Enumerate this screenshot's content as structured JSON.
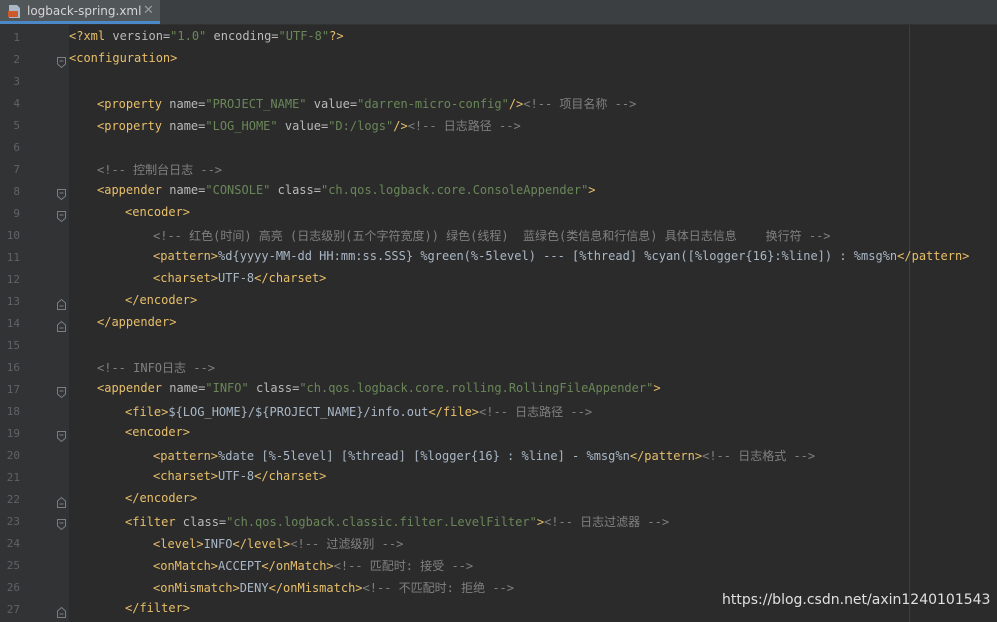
{
  "tab": {
    "label": "logback-spring.xml",
    "close": "✕",
    "icon": "xml-file-icon"
  },
  "lines": [
    {
      "n": "1",
      "fold": "",
      "indent": 0,
      "seg": [
        [
          "t",
          "<?xml "
        ],
        [
          "a",
          "version="
        ],
        [
          "v",
          "\"1.0\""
        ],
        [
          "a",
          " encoding="
        ],
        [
          "v",
          "\"UTF-8\""
        ],
        [
          "t",
          "?>"
        ]
      ]
    },
    {
      "n": "2",
      "fold": "open",
      "indent": 0,
      "seg": [
        [
          "t",
          "<configuration>"
        ]
      ]
    },
    {
      "n": "3",
      "fold": "",
      "indent": 0,
      "seg": []
    },
    {
      "n": "4",
      "fold": "",
      "indent": 1,
      "seg": [
        [
          "t",
          "<property "
        ],
        [
          "a",
          "name="
        ],
        [
          "v",
          "\"PROJECT_NAME\""
        ],
        [
          "a",
          " value="
        ],
        [
          "v",
          "\"darren-micro-config\""
        ],
        [
          "t",
          "/>"
        ],
        [
          "c",
          "<!-- 项目名称 -->"
        ]
      ]
    },
    {
      "n": "5",
      "fold": "",
      "indent": 1,
      "seg": [
        [
          "t",
          "<property "
        ],
        [
          "a",
          "name="
        ],
        [
          "v",
          "\"LOG_HOME\""
        ],
        [
          "a",
          " value="
        ],
        [
          "v",
          "\"D:/logs\""
        ],
        [
          "t",
          "/>"
        ],
        [
          "c",
          "<!-- 日志路径 -->"
        ]
      ]
    },
    {
      "n": "6",
      "fold": "",
      "indent": 0,
      "seg": []
    },
    {
      "n": "7",
      "fold": "",
      "indent": 1,
      "seg": [
        [
          "c",
          "<!-- 控制台日志 -->"
        ]
      ]
    },
    {
      "n": "8",
      "fold": "open",
      "indent": 1,
      "seg": [
        [
          "t",
          "<appender "
        ],
        [
          "a",
          "name="
        ],
        [
          "v",
          "\"CONSOLE\""
        ],
        [
          "a",
          " class="
        ],
        [
          "v",
          "\"ch.qos.logback.core.ConsoleAppender\""
        ],
        [
          "t",
          ">"
        ]
      ]
    },
    {
      "n": "9",
      "fold": "open",
      "indent": 2,
      "seg": [
        [
          "t",
          "<encoder>"
        ]
      ]
    },
    {
      "n": "10",
      "fold": "",
      "indent": 3,
      "seg": [
        [
          "c",
          "<!-- 红色(时间) 高亮 (日志级别(五个字符宽度)) 绿色(线程)  蓝绿色(类信息和行信息) 具体日志信息    换行符 -->"
        ]
      ]
    },
    {
      "n": "11",
      "fold": "",
      "indent": 3,
      "seg": [
        [
          "t",
          "<pattern>"
        ],
        [
          "x",
          "%d{yyyy-MM-dd HH:mm:ss.SSS} %green(%-5level) --- [%thread] %cyan([%logger{16}:%line]) : %msg%n"
        ],
        [
          "t",
          "</pattern>"
        ]
      ]
    },
    {
      "n": "12",
      "fold": "",
      "indent": 3,
      "seg": [
        [
          "t",
          "<charset>"
        ],
        [
          "x",
          "UTF-8"
        ],
        [
          "t",
          "</charset>"
        ]
      ]
    },
    {
      "n": "13",
      "fold": "close",
      "indent": 2,
      "seg": [
        [
          "t",
          "</encoder>"
        ]
      ]
    },
    {
      "n": "14",
      "fold": "close",
      "indent": 1,
      "seg": [
        [
          "t",
          "</appender>"
        ]
      ]
    },
    {
      "n": "15",
      "fold": "",
      "indent": 0,
      "seg": []
    },
    {
      "n": "16",
      "fold": "",
      "indent": 1,
      "seg": [
        [
          "c",
          "<!-- INFO日志 -->"
        ]
      ]
    },
    {
      "n": "17",
      "fold": "open",
      "indent": 1,
      "seg": [
        [
          "t",
          "<appender "
        ],
        [
          "a",
          "name="
        ],
        [
          "v",
          "\"INFO\""
        ],
        [
          "a",
          " class="
        ],
        [
          "v",
          "\"ch.qos.logback.core.rolling.RollingFileAppender\""
        ],
        [
          "t",
          ">"
        ]
      ]
    },
    {
      "n": "18",
      "fold": "",
      "indent": 2,
      "seg": [
        [
          "t",
          "<file>"
        ],
        [
          "x",
          "${LOG_HOME}/${PROJECT_NAME}/info.out"
        ],
        [
          "t",
          "</file>"
        ],
        [
          "c",
          "<!-- 日志路径 -->"
        ]
      ]
    },
    {
      "n": "19",
      "fold": "open",
      "indent": 2,
      "seg": [
        [
          "t",
          "<encoder>"
        ]
      ]
    },
    {
      "n": "20",
      "fold": "",
      "indent": 3,
      "seg": [
        [
          "t",
          "<pattern>"
        ],
        [
          "x",
          "%date [%-5level] [%thread] [%logger{16} : %line] - %msg%n"
        ],
        [
          "t",
          "</pattern>"
        ],
        [
          "c",
          "<!-- 日志格式 -->"
        ]
      ]
    },
    {
      "n": "21",
      "fold": "",
      "indent": 3,
      "seg": [
        [
          "t",
          "<charset>"
        ],
        [
          "x",
          "UTF-8"
        ],
        [
          "t",
          "</charset>"
        ]
      ]
    },
    {
      "n": "22",
      "fold": "close",
      "indent": 2,
      "seg": [
        [
          "t",
          "</encoder>"
        ]
      ]
    },
    {
      "n": "23",
      "fold": "open",
      "indent": 2,
      "seg": [
        [
          "t",
          "<filter "
        ],
        [
          "a",
          "class="
        ],
        [
          "v",
          "\"ch.qos.logback.classic.filter.LevelFilter\""
        ],
        [
          "t",
          ">"
        ],
        [
          "c",
          "<!-- 日志过滤器 -->"
        ]
      ]
    },
    {
      "n": "24",
      "fold": "",
      "indent": 3,
      "seg": [
        [
          "t",
          "<level>"
        ],
        [
          "x",
          "INFO"
        ],
        [
          "t",
          "</level>"
        ],
        [
          "c",
          "<!-- 过滤级别 -->"
        ]
      ]
    },
    {
      "n": "25",
      "fold": "",
      "indent": 3,
      "seg": [
        [
          "t",
          "<onMatch>"
        ],
        [
          "x",
          "ACCEPT"
        ],
        [
          "t",
          "</onMatch>"
        ],
        [
          "c",
          "<!-- 匹配时: 接受 -->"
        ]
      ]
    },
    {
      "n": "26",
      "fold": "",
      "indent": 3,
      "seg": [
        [
          "t",
          "<onMismatch>"
        ],
        [
          "x",
          "DENY"
        ],
        [
          "t",
          "</onMismatch>"
        ],
        [
          "c",
          "<!-- 不匹配时: 拒绝 -->"
        ]
      ]
    },
    {
      "n": "27",
      "fold": "close",
      "indent": 2,
      "seg": [
        [
          "t",
          "</filter>"
        ]
      ]
    }
  ],
  "watermark": "https://blog.csdn.net/axin1240101543",
  "colors": {
    "tag": "#e8bf6a",
    "attr": "#bababa",
    "value": "#6a8759",
    "comment": "#808080",
    "text": "#a9b7c6",
    "background": "#2b2b2b",
    "gutter": "#313335",
    "tab_accent": "#4a88c7"
  }
}
